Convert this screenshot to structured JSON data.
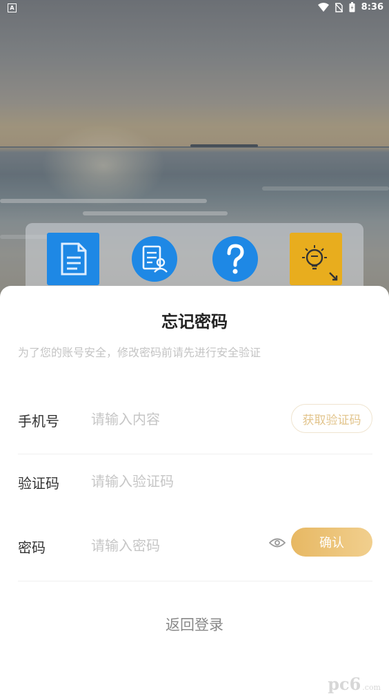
{
  "status_bar": {
    "time": "8:36",
    "left_badge": "A"
  },
  "dialog": {
    "title": "忘记密码",
    "subtitle": "为了您的账号安全，修改密码前请先进行安全验证",
    "fields": {
      "phone": {
        "label": "手机号",
        "placeholder": "请输入内容"
      },
      "code": {
        "label": "验证码",
        "placeholder": "请输入验证码"
      },
      "password": {
        "label": "密码",
        "placeholder": "请输入密码"
      }
    },
    "get_code_label": "获取验证码",
    "confirm_label": "确认",
    "back_label": "返回登录"
  },
  "watermark": {
    "main": "pc6",
    "sub": ".com"
  },
  "colors": {
    "accent": "#e7b863",
    "tile_blue": "#1e88e5",
    "tile_yellow": "#f4b400"
  },
  "icons": [
    "document-icon",
    "resume-icon",
    "question-icon",
    "idea-bulb-icon"
  ]
}
